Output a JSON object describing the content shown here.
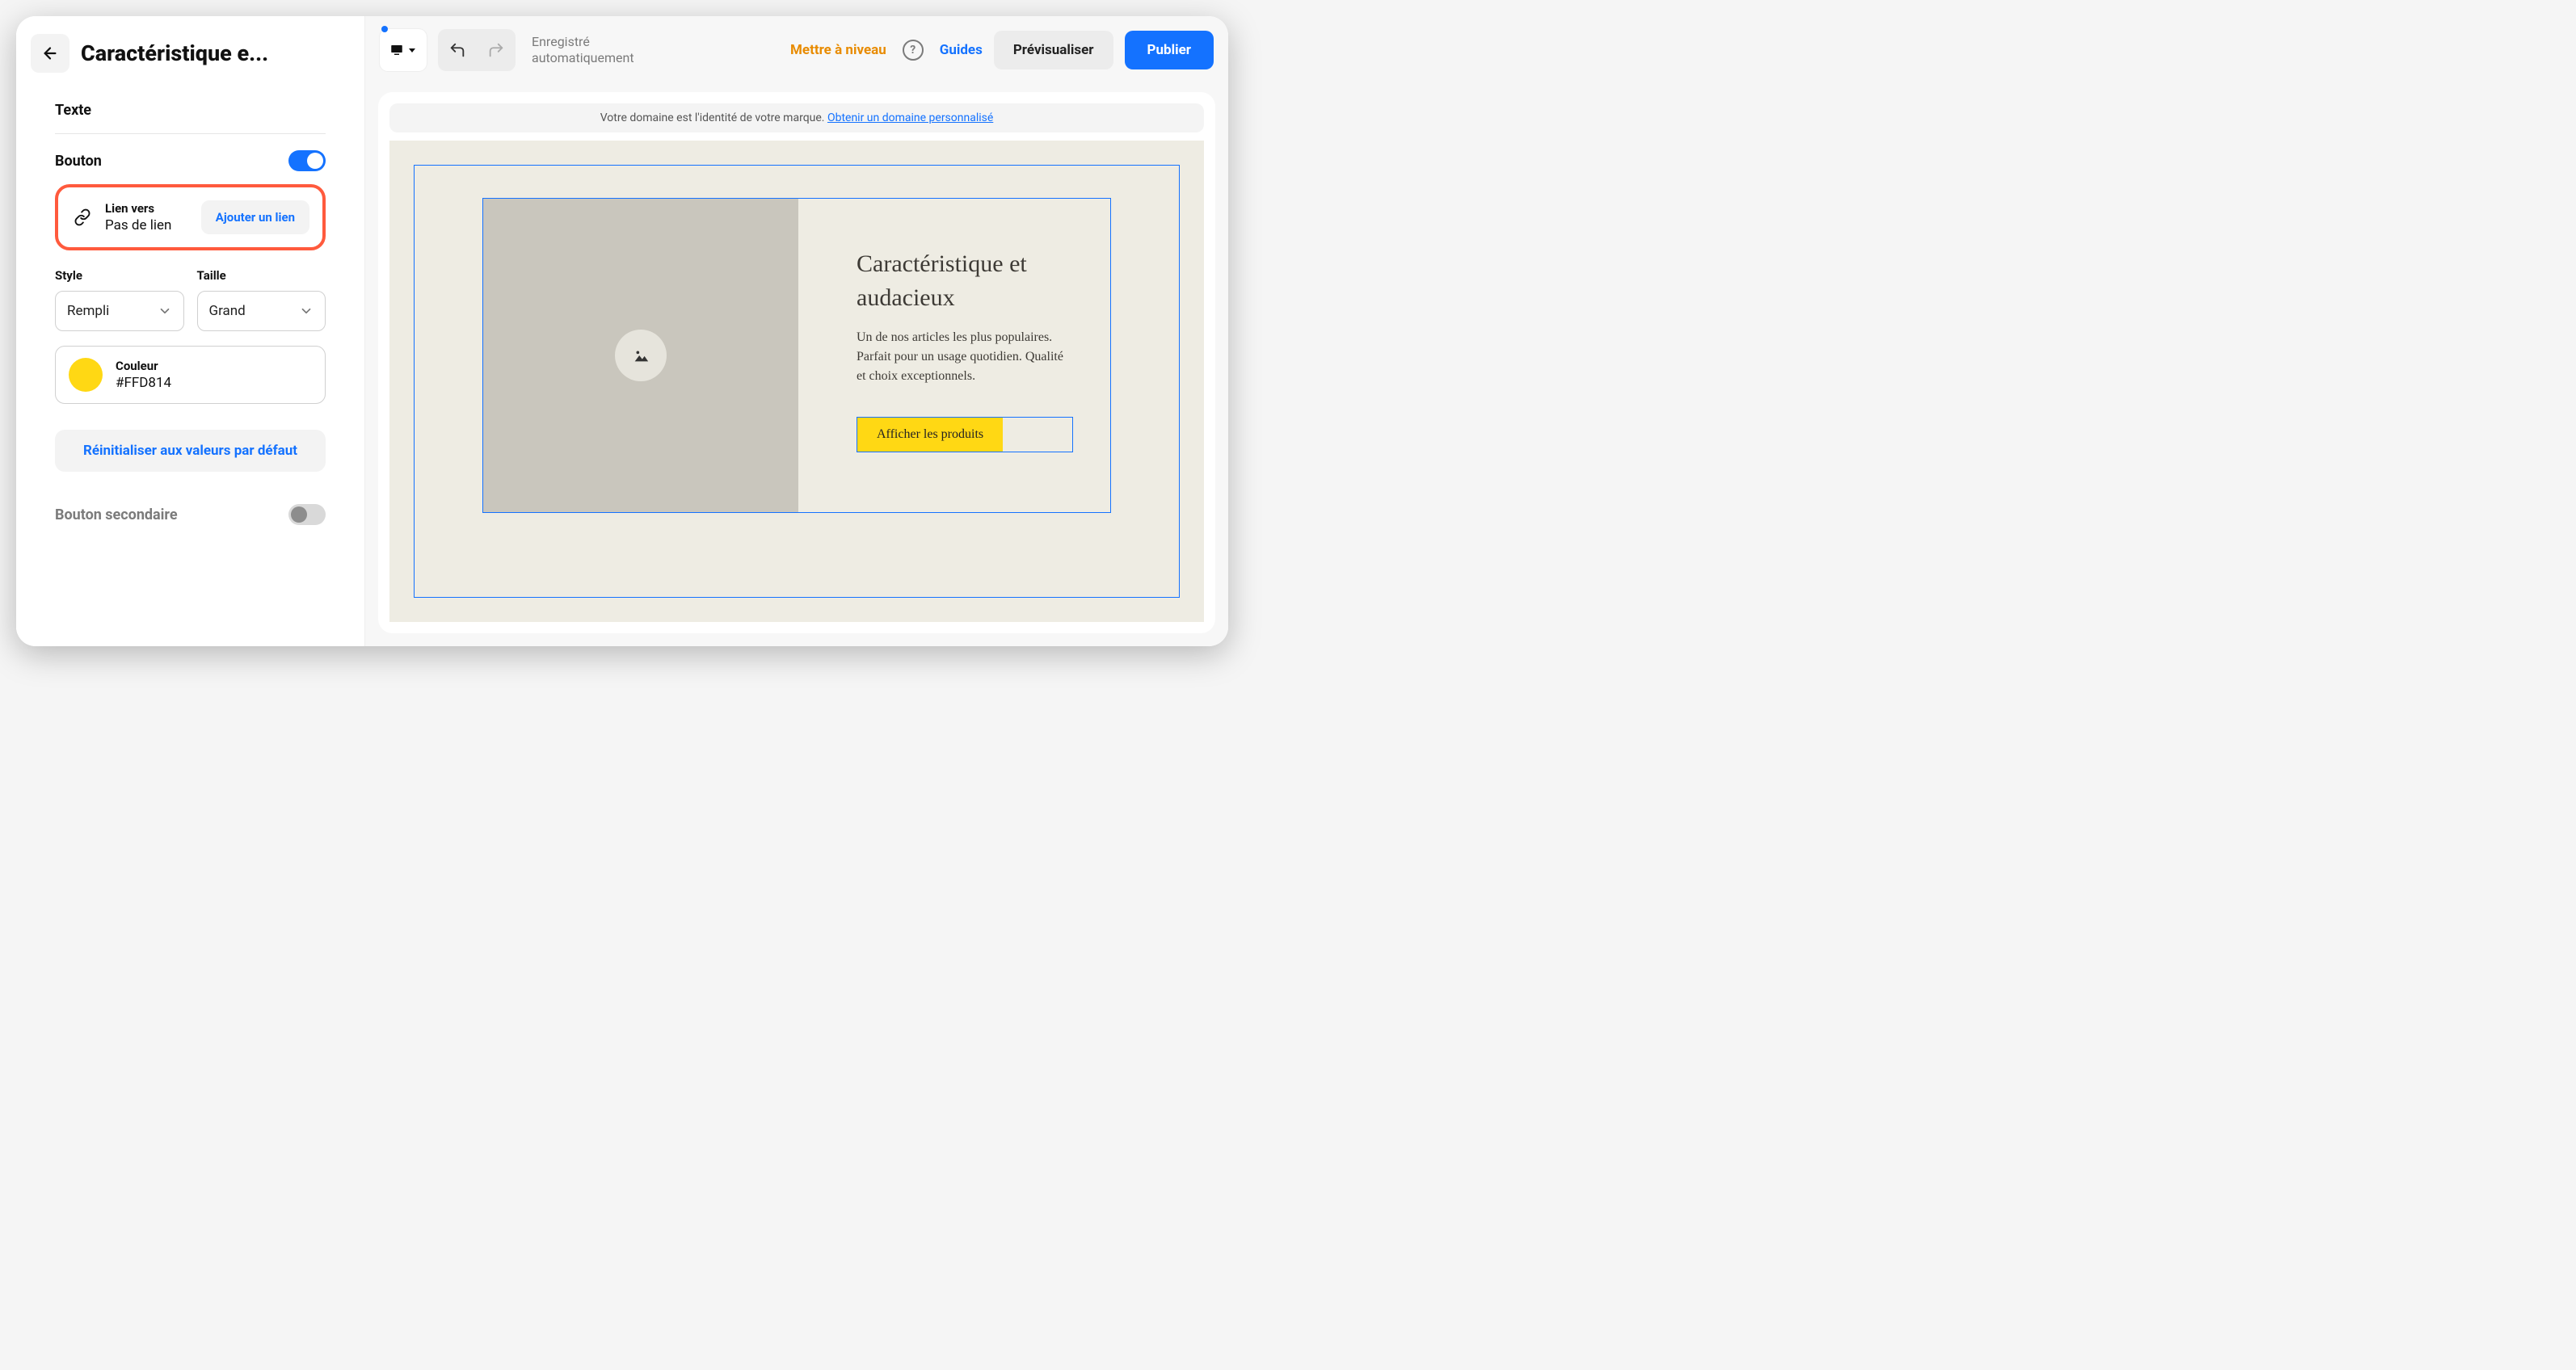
{
  "sidebar": {
    "title": "Caractéristique e...",
    "text_section": "Texte",
    "button_section": "Bouton",
    "link": {
      "label": "Lien vers",
      "value": "Pas de lien",
      "add_button": "Ajouter un lien"
    },
    "style": {
      "label": "Style",
      "value": "Rempli"
    },
    "size": {
      "label": "Taille",
      "value": "Grand"
    },
    "color": {
      "label": "Couleur",
      "value": "#FFD814"
    },
    "reset_button": "Réinitialiser aux valeurs par défaut",
    "secondary_button_label": "Bouton secondaire"
  },
  "topbar": {
    "autosave_line1": "Enregistré",
    "autosave_line2": "automatiquement",
    "upgrade": "Mettre à niveau",
    "guides": "Guides",
    "preview": "Prévisualiser",
    "publish": "Publier"
  },
  "banner": {
    "text": "Votre domaine est l'identité de votre marque. ",
    "link": "Obtenir un domaine personnalisé"
  },
  "canvas": {
    "hero_title": "Caractéristique et audacieux",
    "hero_desc": "Un de nos articles les plus populaires. Parfait pour un usage quotidien. Qualité et choix exceptionnels.",
    "cta": "Afficher les produits"
  }
}
